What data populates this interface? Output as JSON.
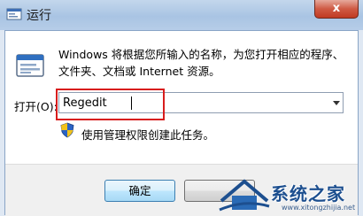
{
  "window": {
    "title": "运行",
    "close_glyph": "x"
  },
  "description": {
    "line1": "Windows 将根据您所输入的名称，为您打开相应的程序、",
    "line2": "文件夹、文档或 Internet 资源。",
    "icon": "run-program-icon"
  },
  "open_field": {
    "label": "打开(O):",
    "value": "Regedit"
  },
  "admin_note": {
    "icon": "uac-shield-icon",
    "text": "使用管理权限创建此任务。"
  },
  "buttons": {
    "ok_label": "确定"
  },
  "watermark": {
    "name": "系统之家",
    "url": "www.xitongzhijia.net"
  },
  "colors": {
    "highlight": "#d81d1d",
    "titlebar": "#b6cde8",
    "close": "#c03a22"
  }
}
